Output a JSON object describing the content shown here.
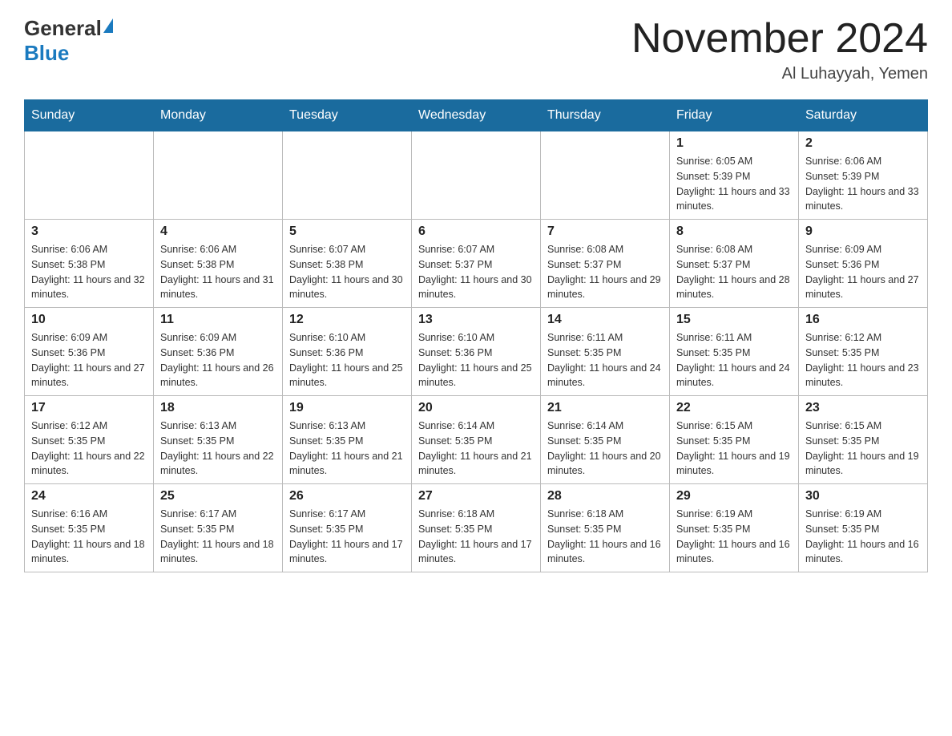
{
  "header": {
    "logo_general": "General",
    "logo_blue": "Blue",
    "title": "November 2024",
    "subtitle": "Al Luhayyah, Yemen"
  },
  "weekdays": [
    "Sunday",
    "Monday",
    "Tuesday",
    "Wednesday",
    "Thursday",
    "Friday",
    "Saturday"
  ],
  "weeks": [
    [
      {
        "day": "",
        "info": ""
      },
      {
        "day": "",
        "info": ""
      },
      {
        "day": "",
        "info": ""
      },
      {
        "day": "",
        "info": ""
      },
      {
        "day": "",
        "info": ""
      },
      {
        "day": "1",
        "info": "Sunrise: 6:05 AM\nSunset: 5:39 PM\nDaylight: 11 hours and 33 minutes."
      },
      {
        "day": "2",
        "info": "Sunrise: 6:06 AM\nSunset: 5:39 PM\nDaylight: 11 hours and 33 minutes."
      }
    ],
    [
      {
        "day": "3",
        "info": "Sunrise: 6:06 AM\nSunset: 5:38 PM\nDaylight: 11 hours and 32 minutes."
      },
      {
        "day": "4",
        "info": "Sunrise: 6:06 AM\nSunset: 5:38 PM\nDaylight: 11 hours and 31 minutes."
      },
      {
        "day": "5",
        "info": "Sunrise: 6:07 AM\nSunset: 5:38 PM\nDaylight: 11 hours and 30 minutes."
      },
      {
        "day": "6",
        "info": "Sunrise: 6:07 AM\nSunset: 5:37 PM\nDaylight: 11 hours and 30 minutes."
      },
      {
        "day": "7",
        "info": "Sunrise: 6:08 AM\nSunset: 5:37 PM\nDaylight: 11 hours and 29 minutes."
      },
      {
        "day": "8",
        "info": "Sunrise: 6:08 AM\nSunset: 5:37 PM\nDaylight: 11 hours and 28 minutes."
      },
      {
        "day": "9",
        "info": "Sunrise: 6:09 AM\nSunset: 5:36 PM\nDaylight: 11 hours and 27 minutes."
      }
    ],
    [
      {
        "day": "10",
        "info": "Sunrise: 6:09 AM\nSunset: 5:36 PM\nDaylight: 11 hours and 27 minutes."
      },
      {
        "day": "11",
        "info": "Sunrise: 6:09 AM\nSunset: 5:36 PM\nDaylight: 11 hours and 26 minutes."
      },
      {
        "day": "12",
        "info": "Sunrise: 6:10 AM\nSunset: 5:36 PM\nDaylight: 11 hours and 25 minutes."
      },
      {
        "day": "13",
        "info": "Sunrise: 6:10 AM\nSunset: 5:36 PM\nDaylight: 11 hours and 25 minutes."
      },
      {
        "day": "14",
        "info": "Sunrise: 6:11 AM\nSunset: 5:35 PM\nDaylight: 11 hours and 24 minutes."
      },
      {
        "day": "15",
        "info": "Sunrise: 6:11 AM\nSunset: 5:35 PM\nDaylight: 11 hours and 24 minutes."
      },
      {
        "day": "16",
        "info": "Sunrise: 6:12 AM\nSunset: 5:35 PM\nDaylight: 11 hours and 23 minutes."
      }
    ],
    [
      {
        "day": "17",
        "info": "Sunrise: 6:12 AM\nSunset: 5:35 PM\nDaylight: 11 hours and 22 minutes."
      },
      {
        "day": "18",
        "info": "Sunrise: 6:13 AM\nSunset: 5:35 PM\nDaylight: 11 hours and 22 minutes."
      },
      {
        "day": "19",
        "info": "Sunrise: 6:13 AM\nSunset: 5:35 PM\nDaylight: 11 hours and 21 minutes."
      },
      {
        "day": "20",
        "info": "Sunrise: 6:14 AM\nSunset: 5:35 PM\nDaylight: 11 hours and 21 minutes."
      },
      {
        "day": "21",
        "info": "Sunrise: 6:14 AM\nSunset: 5:35 PM\nDaylight: 11 hours and 20 minutes."
      },
      {
        "day": "22",
        "info": "Sunrise: 6:15 AM\nSunset: 5:35 PM\nDaylight: 11 hours and 19 minutes."
      },
      {
        "day": "23",
        "info": "Sunrise: 6:15 AM\nSunset: 5:35 PM\nDaylight: 11 hours and 19 minutes."
      }
    ],
    [
      {
        "day": "24",
        "info": "Sunrise: 6:16 AM\nSunset: 5:35 PM\nDaylight: 11 hours and 18 minutes."
      },
      {
        "day": "25",
        "info": "Sunrise: 6:17 AM\nSunset: 5:35 PM\nDaylight: 11 hours and 18 minutes."
      },
      {
        "day": "26",
        "info": "Sunrise: 6:17 AM\nSunset: 5:35 PM\nDaylight: 11 hours and 17 minutes."
      },
      {
        "day": "27",
        "info": "Sunrise: 6:18 AM\nSunset: 5:35 PM\nDaylight: 11 hours and 17 minutes."
      },
      {
        "day": "28",
        "info": "Sunrise: 6:18 AM\nSunset: 5:35 PM\nDaylight: 11 hours and 16 minutes."
      },
      {
        "day": "29",
        "info": "Sunrise: 6:19 AM\nSunset: 5:35 PM\nDaylight: 11 hours and 16 minutes."
      },
      {
        "day": "30",
        "info": "Sunrise: 6:19 AM\nSunset: 5:35 PM\nDaylight: 11 hours and 16 minutes."
      }
    ]
  ]
}
